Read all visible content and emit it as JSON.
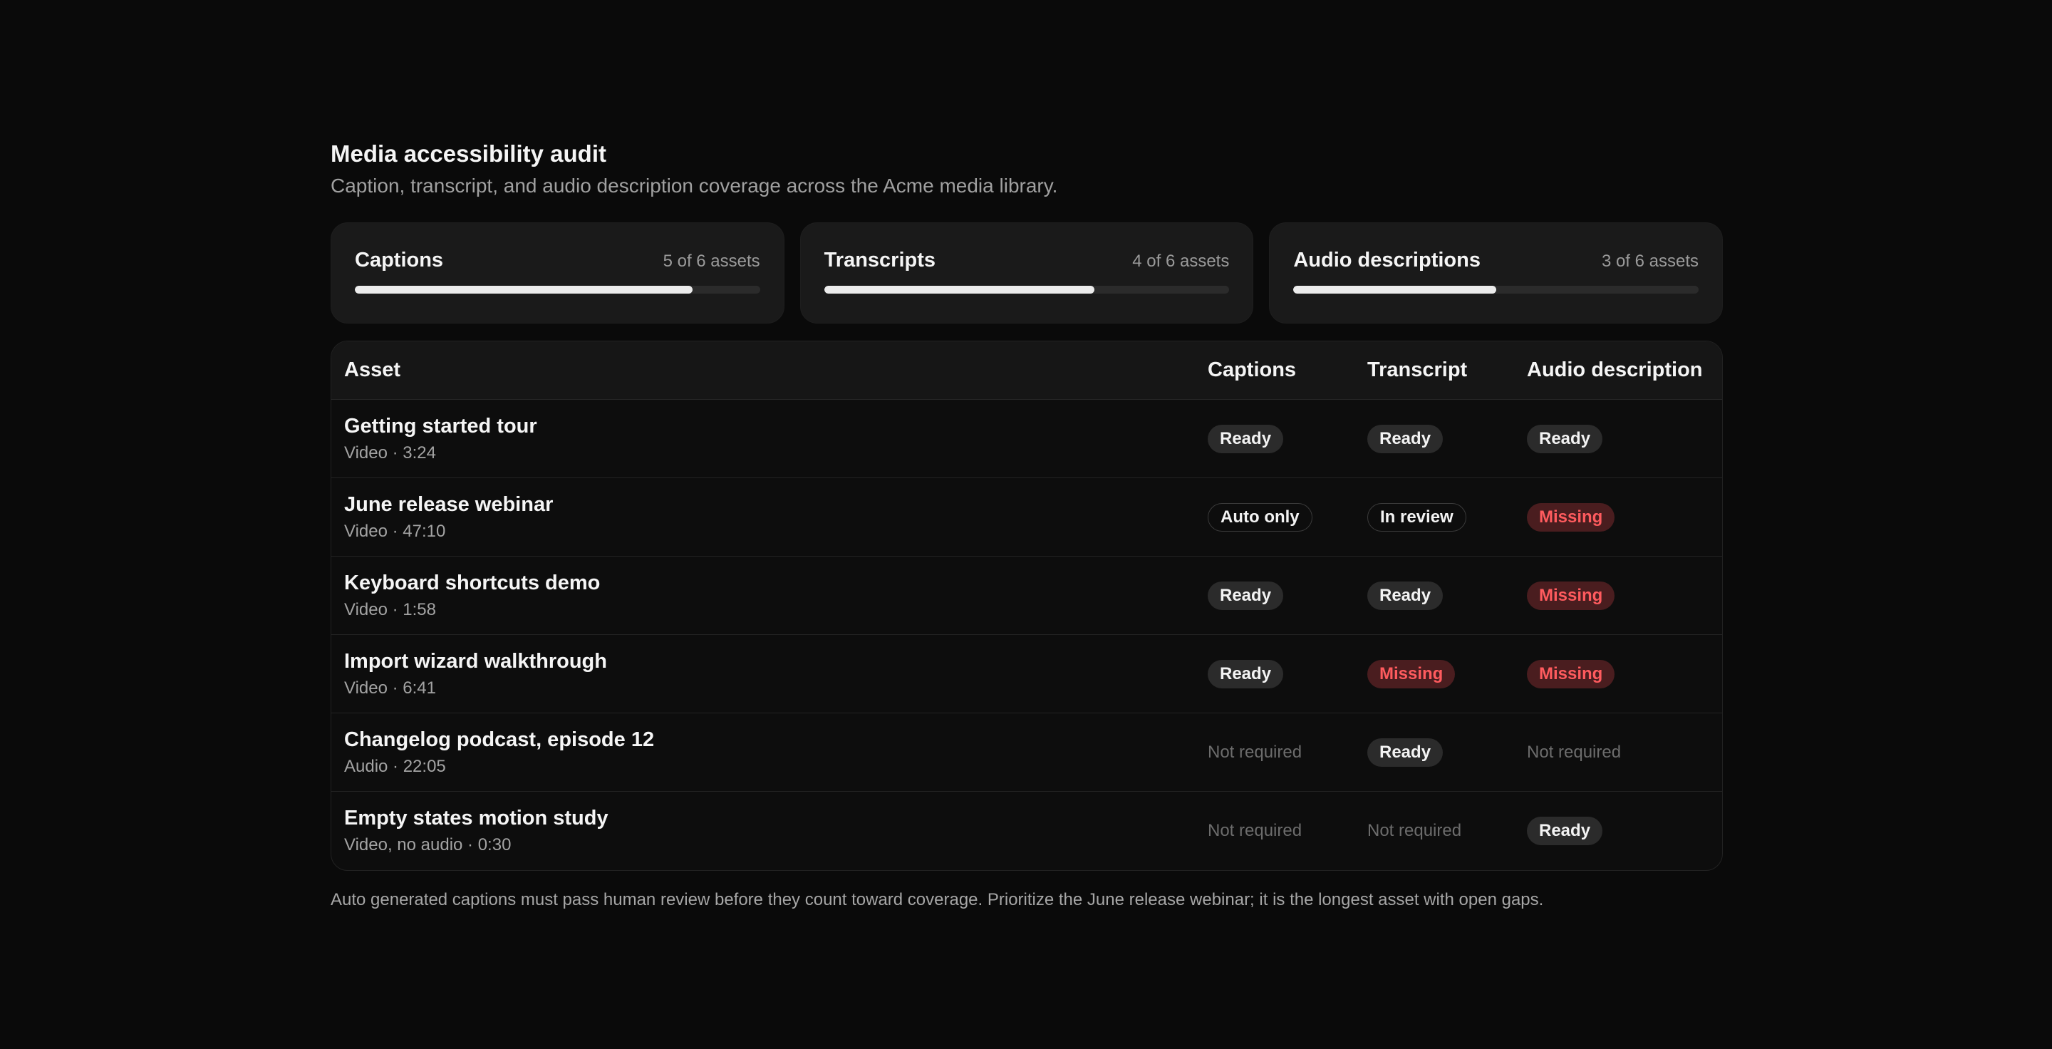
{
  "header": {
    "title": "Media accessibility audit",
    "subtitle": "Caption, transcript, and audio description coverage across the Acme media library."
  },
  "summary": [
    {
      "label": "Captions",
      "count": "5 of 6 assets",
      "done": 5,
      "total": 6
    },
    {
      "label": "Transcripts",
      "count": "4 of 6 assets",
      "done": 4,
      "total": 6
    },
    {
      "label": "Audio descriptions",
      "count": "3 of 6 assets",
      "done": 3,
      "total": 6
    }
  ],
  "table": {
    "columns": [
      "Asset",
      "Captions",
      "Transcript",
      "Audio description"
    ],
    "rows": [
      {
        "name": "Getting started tour",
        "meta": "Video · 3:24",
        "captions": {
          "text": "Ready",
          "status": "ready"
        },
        "transcript": {
          "text": "Ready",
          "status": "ready"
        },
        "audio": {
          "text": "Ready",
          "status": "ready"
        }
      },
      {
        "name": "June release webinar",
        "meta": "Video · 47:10",
        "captions": {
          "text": "Auto only",
          "status": "outline"
        },
        "transcript": {
          "text": "In review",
          "status": "outline"
        },
        "audio": {
          "text": "Missing",
          "status": "missing"
        }
      },
      {
        "name": "Keyboard shortcuts demo",
        "meta": "Video · 1:58",
        "captions": {
          "text": "Ready",
          "status": "ready"
        },
        "transcript": {
          "text": "Ready",
          "status": "ready"
        },
        "audio": {
          "text": "Missing",
          "status": "missing"
        }
      },
      {
        "name": "Import wizard walkthrough",
        "meta": "Video · 6:41",
        "captions": {
          "text": "Ready",
          "status": "ready"
        },
        "transcript": {
          "text": "Missing",
          "status": "missing"
        },
        "audio": {
          "text": "Missing",
          "status": "missing"
        }
      },
      {
        "name": "Changelog podcast, episode 12",
        "meta": "Audio · 22:05",
        "captions": {
          "text": "Not required",
          "status": "muted"
        },
        "transcript": {
          "text": "Ready",
          "status": "ready"
        },
        "audio": {
          "text": "Not required",
          "status": "muted"
        }
      },
      {
        "name": "Empty states motion study",
        "meta": "Video, no audio · 0:30",
        "captions": {
          "text": "Not required",
          "status": "muted"
        },
        "transcript": {
          "text": "Not required",
          "status": "muted"
        },
        "audio": {
          "text": "Ready",
          "status": "ready"
        }
      }
    ]
  },
  "footnote": "Auto generated captions must pass human review before they count toward coverage. Prioritize the June release webinar; it is the longest asset with open gaps.",
  "colors": {
    "background": "#0a0a0a",
    "card": "#1a1a1a",
    "missing_text": "#ff5b5e",
    "missing_bg": "#4a1d1f",
    "ready_bg": "#2b2b2b"
  }
}
